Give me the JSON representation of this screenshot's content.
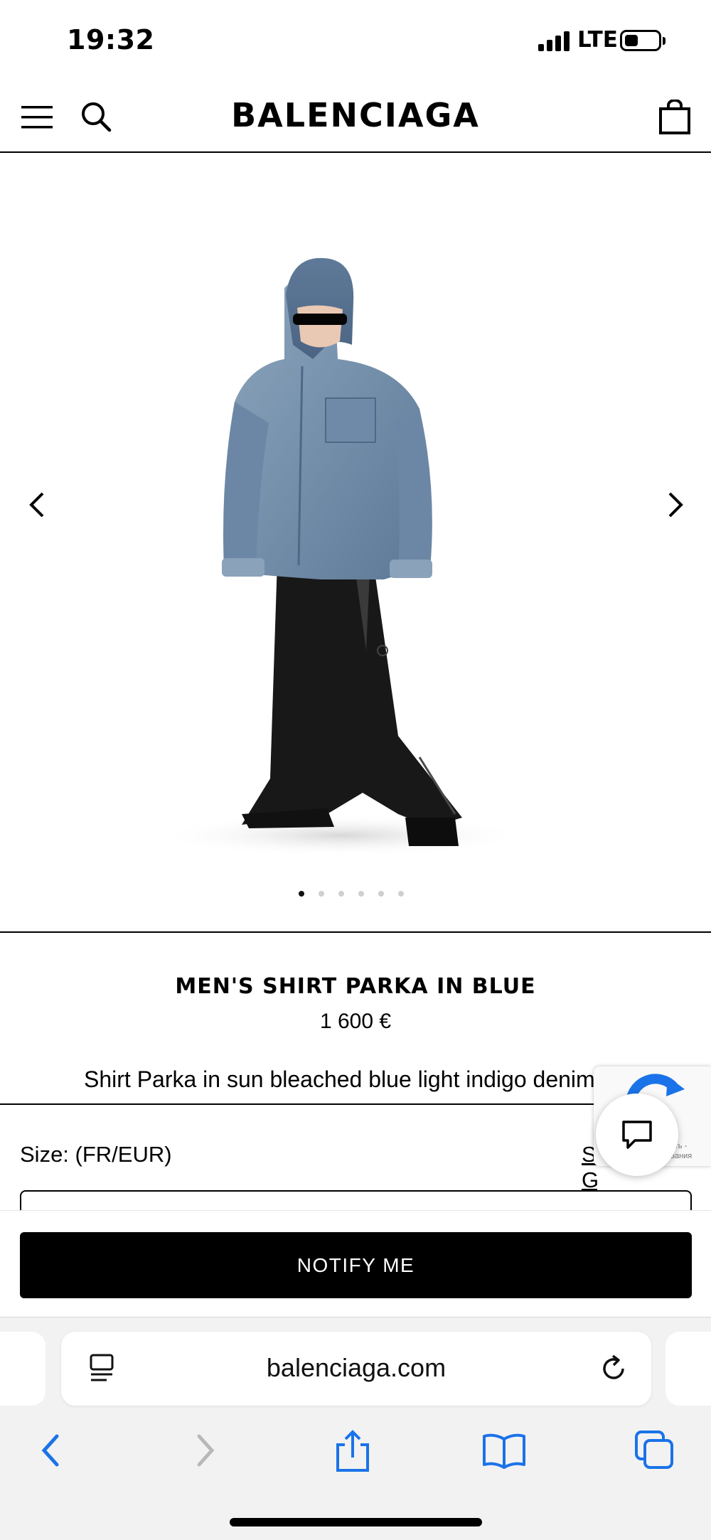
{
  "status_bar": {
    "time": "19:32",
    "network": "LTE"
  },
  "header": {
    "brand": "BALENCIAGA"
  },
  "gallery": {
    "image_count": 6,
    "active_index": 0
  },
  "product": {
    "title": "MEN'S SHIRT PARKA IN BLUE",
    "price": "1 600 €",
    "description": "Shirt Parka in sun bleached blue light indigo denim",
    "size_label": "Size: (FR/EUR)",
    "size_guide_label": "Size Guide",
    "notify_label": "NOTIFY ME"
  },
  "recaptcha": {
    "text_line1": "юсть -",
    "text_line2": "ювания"
  },
  "browser": {
    "url": "balenciaga.com"
  },
  "colors": {
    "accent_blue": "#1a73e8",
    "button_black": "#000000",
    "toolbar_bg": "#f2f2f2"
  }
}
